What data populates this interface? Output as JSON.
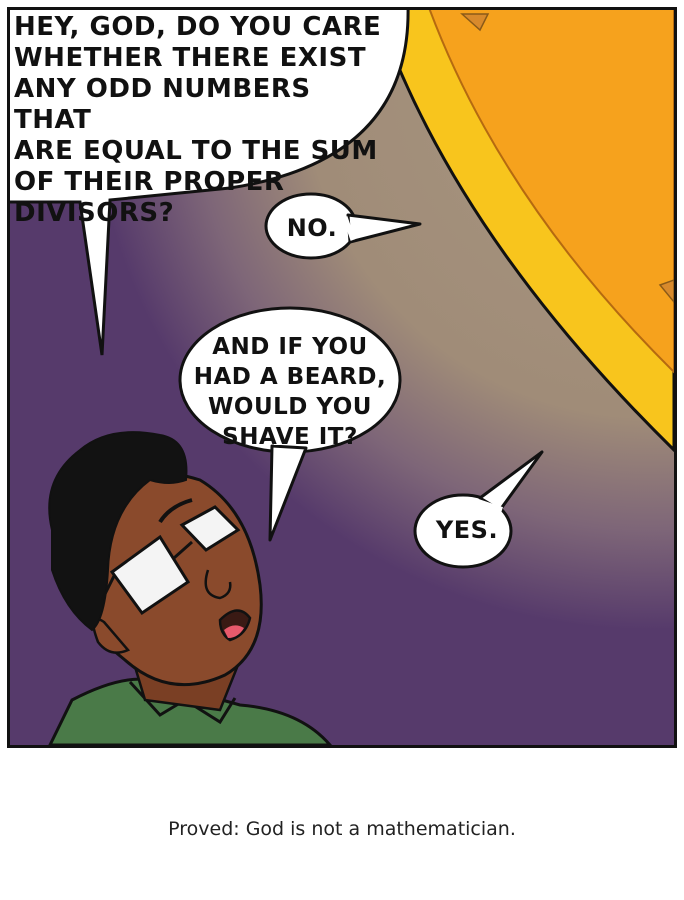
{
  "comic": {
    "bubble_1": "HEY, GOD, DO YOU CARE\nWHETHER THERE EXIST\nANY ODD NUMBERS THAT\nARE EQUAL TO THE SUM\nOF THEIR PROPER\nDIVISORS?",
    "bubble_2": "NO.",
    "bubble_3": "AND IF YOU\nHAD A BEARD,\nWOULD YOU\nSHAVE IT?",
    "bubble_4": "YES."
  },
  "caption": "Proved: God is not a mathematician.",
  "colors": {
    "sky_purple": "#563a6b",
    "god_glow": "#a59279",
    "god_orange": "#f6a21d",
    "god_yellow_rim": "#f8c51d",
    "skin": "#8a4a2c",
    "shirt": "#4a7a48",
    "hair": "#121212"
  }
}
